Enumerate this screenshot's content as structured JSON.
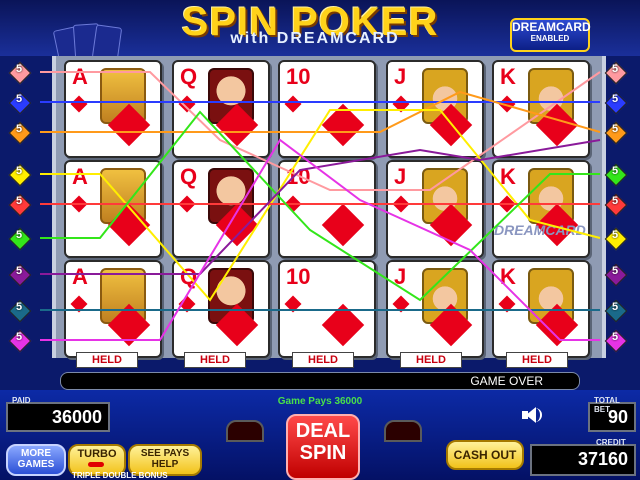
{
  "header": {
    "title": "SPIN POKER",
    "subtitle": "with DREAMCARD",
    "badge_line1": "DREAMCARD",
    "badge_line2": "ENABLED"
  },
  "grid": {
    "rows": [
      [
        {
          "rank": "A",
          "face": "ace",
          "held": true
        },
        {
          "rank": "Q",
          "face": "queen",
          "held": true
        },
        {
          "rank": "10",
          "face": "",
          "held": true
        },
        {
          "rank": "J",
          "face": "king",
          "held": true
        },
        {
          "rank": "K",
          "face": "king",
          "held": true
        }
      ],
      [
        {
          "rank": "A",
          "face": "ace",
          "held": true
        },
        {
          "rank": "Q",
          "face": "queen",
          "held": true
        },
        {
          "rank": "10",
          "face": "",
          "held": true
        },
        {
          "rank": "J",
          "face": "king",
          "held": true
        },
        {
          "rank": "K",
          "face": "king",
          "held": true
        }
      ],
      [
        {
          "rank": "A",
          "face": "ace",
          "held": true
        },
        {
          "rank": "Q",
          "face": "queen",
          "held": true
        },
        {
          "rank": "10",
          "face": "",
          "held": true
        },
        {
          "rank": "J",
          "face": "king",
          "held": true
        },
        {
          "rank": "K",
          "face": "king",
          "held": true
        }
      ]
    ],
    "wild_label": "DREAMCARD",
    "held_label": "HELD"
  },
  "paylines": {
    "left": [
      {
        "n": "5",
        "color": "#ff9aa0"
      },
      {
        "n": "5",
        "color": "#2a3cff"
      },
      {
        "n": "5",
        "color": "#ff9a1a"
      },
      {
        "n": "5",
        "color": "#ffee00"
      },
      {
        "n": "5",
        "color": "#ff3a3a"
      },
      {
        "n": "5",
        "color": "#33e61a"
      },
      {
        "n": "5",
        "color": "#8a1a9a"
      },
      {
        "n": "5",
        "color": "#1a6a8a"
      },
      {
        "n": "5",
        "color": "#e633e6"
      }
    ],
    "right": [
      {
        "n": "5",
        "color": "#ff9aa0"
      },
      {
        "n": "5",
        "color": "#2a3cff"
      },
      {
        "n": "5",
        "color": "#ff9a1a"
      },
      {
        "n": "5",
        "color": "#33e61a"
      },
      {
        "n": "5",
        "color": "#ff3a3a"
      },
      {
        "n": "5",
        "color": "#ffee00"
      },
      {
        "n": "5",
        "color": "#8a1a9a"
      },
      {
        "n": "5",
        "color": "#1a6a8a"
      },
      {
        "n": "5",
        "color": "#e633e6"
      }
    ]
  },
  "status": {
    "message": "GAME OVER",
    "game_pays": "Game Pays 36000"
  },
  "meters": {
    "paid_label": "PAID",
    "paid_value": "36000",
    "total_bet_label": "TOTAL BET",
    "total_bet_value": "90",
    "credit_label": "CREDIT",
    "credit_value": "37160"
  },
  "buttons": {
    "more_games_1": "MORE",
    "more_games_2": "GAMES",
    "turbo": "TURBO",
    "see_pays_1": "SEE PAYS",
    "see_pays_2": "HELP",
    "deal_1": "DEAL",
    "deal_2": "SPIN",
    "cash_out": "CASH OUT"
  },
  "footer": {
    "game_name": "TRIPLE DOUBLE BONUS"
  }
}
